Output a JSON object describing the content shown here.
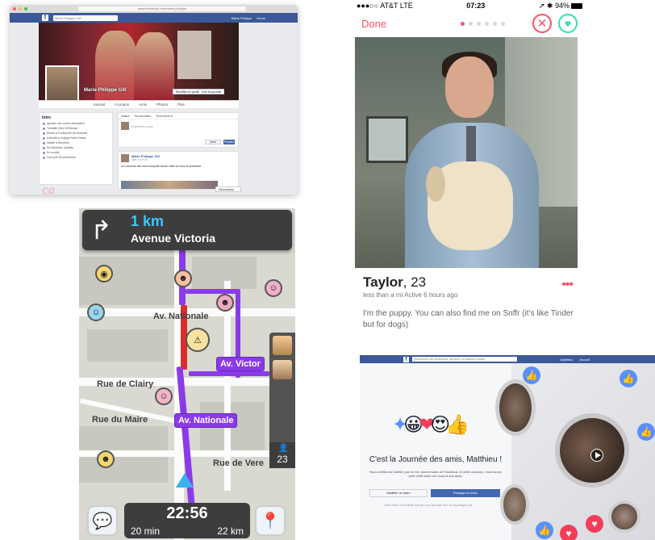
{
  "facebook_profile": {
    "url": "www.facebook.com/marie.philippe",
    "search_placeholder": "Marie-Philippe Gill",
    "header_user": "Marie-Philippe",
    "header_home": "Home",
    "profile_name": "Marie-Philippe Gill",
    "cover_buttons": [
      "Modifier le profil",
      "Voir le journal"
    ],
    "tabs": [
      "Journal",
      "À propos",
      "Amis",
      "Photos",
      "Plus"
    ],
    "intro_title": "Intro",
    "intro_lines": [
      "Ajoutez une courte description",
      "Travaille chez OKNeelys",
      "Etudie à l'Université de Montréal",
      "A étudié à Collège Notre-Dame",
      "Habite à Montréal",
      "De Montréal, Québec",
      "En couple",
      "Suivi par 32 personnes"
    ],
    "composer_tabs": [
      "Statut",
      "Photo/vidéo",
      "Événement"
    ],
    "composer_placeholder": "Exprimez-vous",
    "composer_audience": "Amis",
    "composer_publish": "Publier",
    "post_author": "Marie-Philippe Gill",
    "post_time": "Hier, à 15:30",
    "post_text": "Un nouveau site web tout juste lancé! Hâte de vous le présenter.",
    "chat_label": "Discussion",
    "footer_logo": "ça"
  },
  "tinder": {
    "carrier": "AT&T LTE",
    "time": "07:23",
    "battery": "94%",
    "done_label": "Done",
    "dots": 6,
    "active_dot": 0,
    "name": "Taylor",
    "age": ", 23",
    "distance": "less than a mi  Active 6 hours ago",
    "bio": "I'm the puppy. You can also find me on Snffr (it's like Tinder but for dogs)",
    "more": "•••",
    "colors": {
      "accent": "#fd5068",
      "like": "#2de3b1"
    }
  },
  "waze": {
    "distance": "1 km",
    "street": "Avenue Victoria",
    "labels": {
      "nationale": "Av. Nationale",
      "clairy": "Rue de Clairy",
      "maire": "Rue du Maire",
      "vere": "Rue de Vere"
    },
    "pills": {
      "victoria": "Av. Victor",
      "nationale": "Av. Nationale"
    },
    "eta_time": "22:56",
    "eta_minutes": "20 min",
    "eta_distance": "22 km",
    "nearby_count": "23",
    "colors": {
      "route": "#8a3be8",
      "traffic": "#d82e2e",
      "accent": "#3cc8ff"
    }
  },
  "friends_day": {
    "search_placeholder": "Rechercher des personnes, des lieux ou d'autres choses",
    "user": "Matthieu",
    "home": "Accueil",
    "heading": "C'est la Journée des amis, Matthieu !",
    "subtitle": "Nous célébrons l'amitié pour le 12e anniversaire de Facebook. À cette occasion, nous avons créé cette vidéo sur vous et vos amis.",
    "button_edit": "Modifier la vidéo",
    "button_share": "Partager la vidéo",
    "note": "Cette vidéo n'est visible que par vous tant que vous ne la partagez pas"
  }
}
